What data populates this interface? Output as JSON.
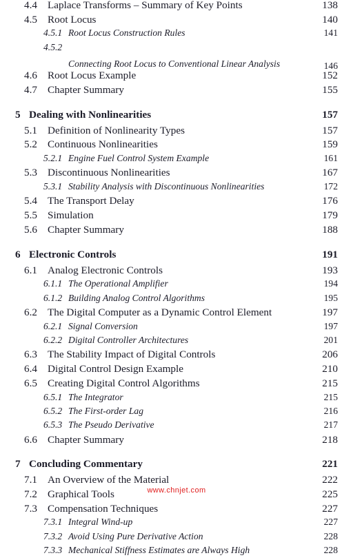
{
  "document": {
    "type": "table-of-contents",
    "text_color": "#1b1b28",
    "background_color": "#ffffff"
  },
  "watermark": {
    "text": "www.chnjet.com",
    "color": "#e02020"
  },
  "entries": [
    {
      "level": "section",
      "number": "4.4",
      "title": "Laplace Transforms – Summary of Key Points",
      "page": "138"
    },
    {
      "level": "section",
      "number": "4.5",
      "title": "Root Locus",
      "page": "140"
    },
    {
      "level": "subsection",
      "number": "4.5.1",
      "title": "Root Locus Construction Rules",
      "page": "141"
    },
    {
      "level": "subsection",
      "number": "4.5.2",
      "title": "Connecting Root Locus to Conventional Linear Analysis",
      "page": "146",
      "wrap": true
    },
    {
      "level": "section",
      "number": "4.6",
      "title": "Root Locus Example",
      "page": "152"
    },
    {
      "level": "section",
      "number": "4.7",
      "title": "Chapter Summary",
      "page": "155"
    },
    {
      "level": "chapter",
      "number": "5",
      "title": "Dealing with Nonlinearities",
      "page": "157",
      "gap_before": true
    },
    {
      "level": "section",
      "number": "5.1",
      "title": "Definition of Nonlinearity Types",
      "page": "157"
    },
    {
      "level": "section",
      "number": "5.2",
      "title": "Continuous Nonlinearities",
      "page": "159"
    },
    {
      "level": "subsection",
      "number": "5.2.1",
      "title": "Engine Fuel Control System Example",
      "page": "161"
    },
    {
      "level": "section",
      "number": "5.3",
      "title": "Discontinuous Nonlinearities",
      "page": "167"
    },
    {
      "level": "subsection",
      "number": "5.3.1",
      "title": "Stability Analysis with Discontinuous Nonlinearities",
      "page": "172"
    },
    {
      "level": "section",
      "number": "5.4",
      "title": "The Transport Delay",
      "page": "176"
    },
    {
      "level": "section",
      "number": "5.5",
      "title": "Simulation",
      "page": "179"
    },
    {
      "level": "section",
      "number": "5.6",
      "title": "Chapter Summary",
      "page": "188"
    },
    {
      "level": "chapter",
      "number": "6",
      "title": "Electronic Controls",
      "page": "191",
      "gap_before": true
    },
    {
      "level": "section",
      "number": "6.1",
      "title": "Analog Electronic Controls",
      "page": "193"
    },
    {
      "level": "subsection",
      "number": "6.1.1",
      "title": "The Operational Amplifier",
      "page": "194"
    },
    {
      "level": "subsection",
      "number": "6.1.2",
      "title": "Building Analog Control Algorithms",
      "page": "195"
    },
    {
      "level": "section",
      "number": "6.2",
      "title": "The Digital Computer as a Dynamic Control Element",
      "page": "197"
    },
    {
      "level": "subsection",
      "number": "6.2.1",
      "title": "Signal Conversion",
      "page": "197"
    },
    {
      "level": "subsection",
      "number": "6.2.2",
      "title": "Digital Controller Architectures",
      "page": "201"
    },
    {
      "level": "section",
      "number": "6.3",
      "title": "The Stability Impact of Digital Controls",
      "page": "206"
    },
    {
      "level": "section",
      "number": "6.4",
      "title": "Digital Control Design Example",
      "page": "210"
    },
    {
      "level": "section",
      "number": "6.5",
      "title": "Creating Digital Control Algorithms",
      "page": "215"
    },
    {
      "level": "subsection",
      "number": "6.5.1",
      "title": "The Integrator",
      "page": "215"
    },
    {
      "level": "subsection",
      "number": "6.5.2",
      "title": "The First-order Lag",
      "page": "216"
    },
    {
      "level": "subsection",
      "number": "6.5.3",
      "title": "The Pseudo Derivative",
      "page": "217"
    },
    {
      "level": "section",
      "number": "6.6",
      "title": "Chapter Summary",
      "page": "218"
    },
    {
      "level": "chapter",
      "number": "7",
      "title": "Concluding Commentary",
      "page": "221",
      "gap_before": true
    },
    {
      "level": "section",
      "number": "7.1",
      "title": "An Overview of the Material",
      "page": "222"
    },
    {
      "level": "section",
      "number": "7.2",
      "title": "Graphical Tools",
      "page": "225"
    },
    {
      "level": "section",
      "number": "7.3",
      "title": "Compensation Techniques",
      "page": "227"
    },
    {
      "level": "subsection",
      "number": "7.3.1",
      "title": "Integral Wind-up",
      "page": "227"
    },
    {
      "level": "subsection",
      "number": "7.3.2",
      "title": "Avoid Using Pure Derivative Action",
      "page": "228"
    },
    {
      "level": "subsection",
      "number": "7.3.3",
      "title": "Mechanical Stiffness Estimates are Always High",
      "page": "228"
    }
  ]
}
